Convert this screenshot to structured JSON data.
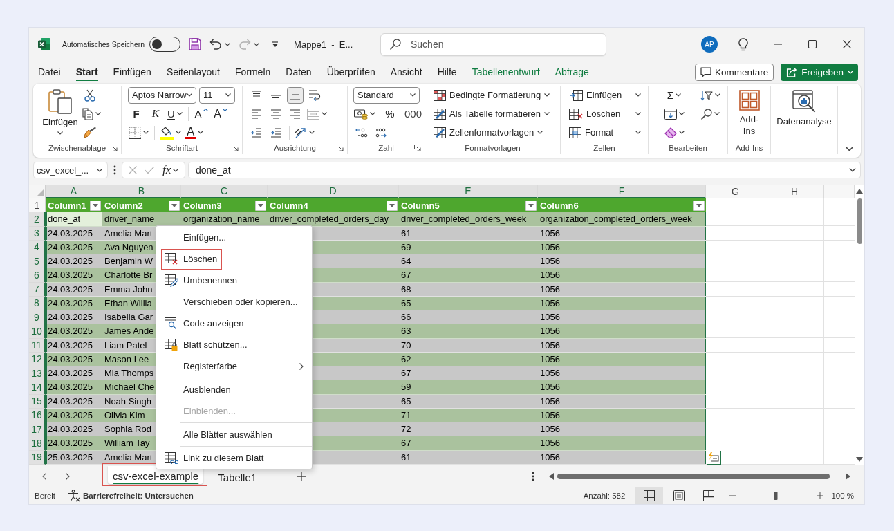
{
  "window": {
    "autosave": {
      "label": "Automatisches Speichern",
      "on": false
    },
    "redo": {
      "disabled": true
    },
    "title": "Mappe1  -  E...",
    "search": {
      "placeholder": "Suchen"
    },
    "account": {
      "initials": "AP"
    }
  },
  "ribbon_tabs": [
    {
      "label": "Datei",
      "selected": false,
      "contextual": false
    },
    {
      "label": "Start",
      "selected": true,
      "contextual": false
    },
    {
      "label": "Einfügen",
      "selected": false,
      "contextual": false
    },
    {
      "label": "Seitenlayout",
      "selected": false,
      "contextual": false
    },
    {
      "label": "Formeln",
      "selected": false,
      "contextual": false
    },
    {
      "label": "Daten",
      "selected": false,
      "contextual": false
    },
    {
      "label": "Überprüfen",
      "selected": false,
      "contextual": false
    },
    {
      "label": "Ansicht",
      "selected": false,
      "contextual": false
    },
    {
      "label": "Hilfe",
      "selected": false,
      "contextual": false
    },
    {
      "label": "Tabellenentwurf",
      "selected": false,
      "contextual": true
    },
    {
      "label": "Abfrage",
      "selected": false,
      "contextual": true
    }
  ],
  "ribbon_actions": {
    "comments": "Kommentare",
    "share": "Freigeben"
  },
  "ribbon": {
    "clipboard": {
      "label": "Zwischenablage",
      "paste": "Einfügen"
    },
    "font": {
      "label": "Schriftart",
      "font_name": "Aptos Narrow",
      "font_size": "11",
      "bold": "F",
      "italic": "K",
      "underline": "U",
      "grow": "A",
      "shrink": "A",
      "font_color": "A"
    },
    "alignment": {
      "label": "Ausrichtung",
      "vertical": [
        {
          "selected": false
        },
        {
          "selected": false
        },
        {
          "selected": true
        }
      ],
      "merge": {
        "disabled": true
      }
    },
    "number": {
      "label": "Zahl",
      "format": "Standard",
      "percent": "%",
      "thousands": "000"
    },
    "styles": {
      "label": "Formatvorlagen",
      "items": [
        "Bedingte Formatierung",
        "Als Tabelle formatieren",
        "Zellenformatvorlagen"
      ]
    },
    "cells": {
      "label": "Zellen",
      "items": [
        "Einfügen",
        "Löschen",
        "Format"
      ]
    },
    "editing": {
      "label": "Bearbeiten",
      "autosum": "Σ"
    },
    "addins": {
      "label": "Add-Ins",
      "button": "Add-Ins"
    },
    "analysis": {
      "button": "Datenanalyse"
    }
  },
  "formula_bar": {
    "name_box": "csv_excel_...",
    "function": "fx",
    "formula": "done_at"
  },
  "sheet": {
    "columns": [
      {
        "label": "A",
        "selected": true
      },
      {
        "label": "B",
        "selected": true
      },
      {
        "label": "C",
        "selected": true
      },
      {
        "label": "D",
        "selected": true
      },
      {
        "label": "E",
        "selected": true
      },
      {
        "label": "F",
        "selected": true
      },
      {
        "label": "G",
        "selected": false
      },
      {
        "label": "H",
        "selected": false
      }
    ],
    "header_row": {
      "number": "1",
      "selected": false,
      "cells": [
        "Column1",
        "Column2",
        "Column3",
        "Column4",
        "Column5",
        "Column6"
      ]
    },
    "rows": [
      {
        "number": "2",
        "selected": true,
        "cursor": true,
        "cells": [
          "done_at",
          "driver_name",
          "organization_name",
          "driver_completed_orders_day",
          "driver_completed_orders_week",
          "organization_completed_orders_week"
        ]
      },
      {
        "number": "3",
        "selected": true,
        "cursor": false,
        "cells": [
          "24.03.2025",
          "Amelia Mart",
          null,
          null,
          "61",
          "1056"
        ]
      },
      {
        "number": "4",
        "selected": true,
        "cursor": false,
        "cells": [
          "24.03.2025",
          "Ava Nguyen",
          null,
          null,
          "69",
          "1056"
        ]
      },
      {
        "number": "5",
        "selected": true,
        "cursor": false,
        "cells": [
          "24.03.2025",
          "Benjamin W",
          null,
          null,
          "64",
          "1056"
        ]
      },
      {
        "number": "6",
        "selected": true,
        "cursor": false,
        "cells": [
          "24.03.2025",
          "Charlotte Br",
          null,
          null,
          "67",
          "1056"
        ]
      },
      {
        "number": "7",
        "selected": true,
        "cursor": false,
        "cells": [
          "24.03.2025",
          "Emma John",
          null,
          null,
          "68",
          "1056"
        ]
      },
      {
        "number": "8",
        "selected": true,
        "cursor": false,
        "cells": [
          "24.03.2025",
          "Ethan Willia",
          null,
          null,
          "65",
          "1056"
        ]
      },
      {
        "number": "9",
        "selected": true,
        "cursor": false,
        "cells": [
          "24.03.2025",
          "Isabella Gar",
          null,
          null,
          "66",
          "1056"
        ]
      },
      {
        "number": "10",
        "selected": true,
        "cursor": false,
        "cells": [
          "24.03.2025",
          "James Ande",
          null,
          null,
          "63",
          "1056"
        ]
      },
      {
        "number": "11",
        "selected": true,
        "cursor": false,
        "cells": [
          "24.03.2025",
          "Liam Patel",
          null,
          null,
          "70",
          "1056"
        ]
      },
      {
        "number": "12",
        "selected": true,
        "cursor": false,
        "cells": [
          "24.03.2025",
          "Mason Lee",
          null,
          null,
          "62",
          "1056"
        ]
      },
      {
        "number": "13",
        "selected": true,
        "cursor": false,
        "cells": [
          "24.03.2025",
          "Mia Thomps",
          null,
          null,
          "67",
          "1056"
        ]
      },
      {
        "number": "14",
        "selected": true,
        "cursor": false,
        "cells": [
          "24.03.2025",
          "Michael Che",
          null,
          null,
          "59",
          "1056"
        ]
      },
      {
        "number": "15",
        "selected": true,
        "cursor": false,
        "cells": [
          "24.03.2025",
          "Noah Singh",
          null,
          null,
          "65",
          "1056"
        ]
      },
      {
        "number": "16",
        "selected": true,
        "cursor": false,
        "cells": [
          "24.03.2025",
          "Olivia Kim",
          null,
          null,
          "71",
          "1056"
        ]
      },
      {
        "number": "17",
        "selected": true,
        "cursor": false,
        "cells": [
          "24.03.2025",
          "Sophia Rod",
          null,
          null,
          "72",
          "1056"
        ]
      },
      {
        "number": "18",
        "selected": true,
        "cursor": false,
        "cells": [
          "24.03.2025",
          "William Tay",
          null,
          null,
          "67",
          "1056"
        ]
      },
      {
        "number": "19",
        "selected": true,
        "cursor": false,
        "cells": [
          "25.03.2025",
          "Amelia Mart",
          null,
          null,
          "61",
          "1056"
        ]
      }
    ]
  },
  "context_menu": {
    "items": [
      {
        "kind": "command",
        "label": "Einfügen...",
        "disabled": false,
        "outlined": false
      },
      {
        "kind": "command",
        "label": "Löschen",
        "disabled": false,
        "outlined": true
      },
      {
        "kind": "command",
        "label": "Umbenennen",
        "disabled": false,
        "outlined": false
      },
      {
        "kind": "command",
        "label": "Verschieben oder kopieren...",
        "disabled": false,
        "outlined": false
      },
      {
        "kind": "command",
        "label": "Code anzeigen",
        "disabled": false,
        "outlined": false
      },
      {
        "kind": "command",
        "label": "Blatt schützen...",
        "disabled": false,
        "outlined": false
      },
      {
        "kind": "submenu",
        "label": "Registerfarbe",
        "disabled": false,
        "outlined": false
      },
      {
        "kind": "separator"
      },
      {
        "kind": "command",
        "label": "Ausblenden",
        "disabled": false,
        "outlined": false
      },
      {
        "kind": "command",
        "label": "Einblenden...",
        "disabled": true,
        "outlined": false
      },
      {
        "kind": "separator"
      },
      {
        "kind": "command",
        "label": "Alle Blätter auswählen",
        "disabled": false,
        "outlined": false
      },
      {
        "kind": "separator"
      },
      {
        "kind": "command",
        "label": "Link zu diesem Blatt",
        "disabled": false,
        "outlined": false
      }
    ]
  },
  "sheet_tabs": [
    {
      "label": "csv-excel-example",
      "selected": true,
      "outlined": true
    },
    {
      "label": "Tabelle1",
      "selected": false,
      "outlined": false
    }
  ],
  "status_bar": {
    "mode": "Bereit",
    "accessibility": "Barrierefreiheit: Untersuchen",
    "count": "Anzahl: 582",
    "views": [
      {
        "selected": true
      },
      {
        "selected": false
      },
      {
        "selected": false
      }
    ],
    "zoom": {
      "level": 0.5,
      "reading": "100 %"
    }
  }
}
